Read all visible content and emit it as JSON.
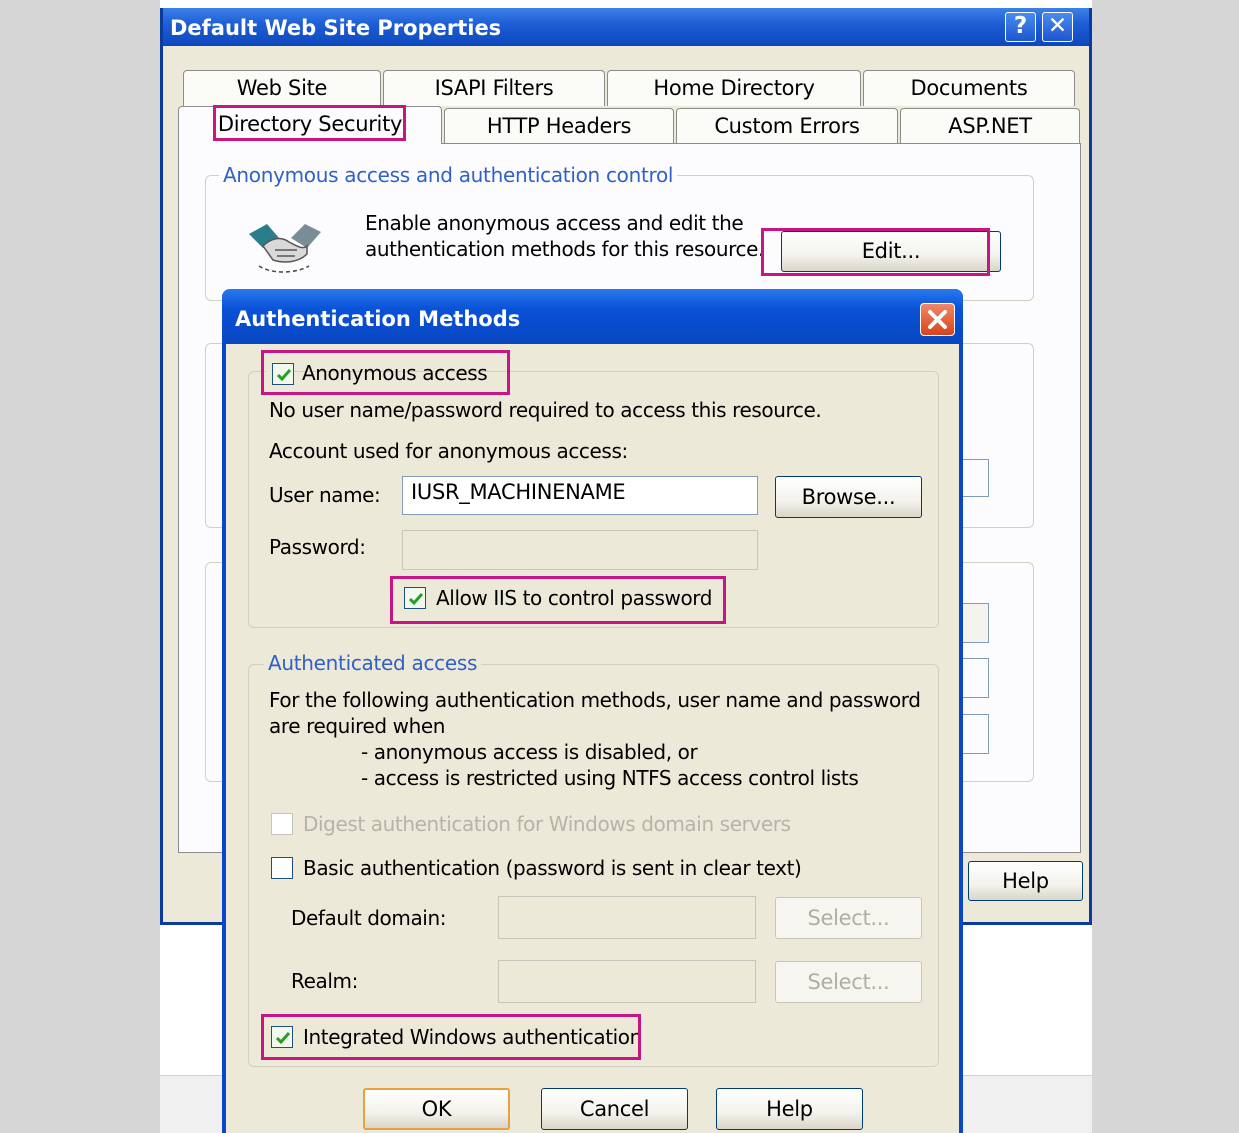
{
  "outer_dialog": {
    "title": "Default Web Site Properties",
    "help_glyph": "?",
    "close_glyph": "✕",
    "tabs_row1": [
      "Web Site",
      "ISAPI Filters",
      "Home Directory",
      "Documents"
    ],
    "tabs_row2": [
      "Directory Security",
      "HTTP Headers",
      "Custom Errors",
      "ASP.NET"
    ],
    "active_tab": "Directory Security",
    "anon_group": {
      "legend": "Anonymous access and authentication control",
      "description_line1": "Enable anonymous access and edit the",
      "description_line2": "authentication methods for this resource.",
      "edit_button": "Edit...",
      "icon": "handshake-icon"
    },
    "help_button": "Help"
  },
  "auth_dialog": {
    "title": "Authentication Methods",
    "close_icon": "close-icon",
    "anonymous": {
      "checkbox_label": "Anonymous access",
      "checked": true,
      "description": "No user name/password required to access this resource.",
      "account_caption": "Account used for anonymous access:",
      "username_label": "User name:",
      "username_value": "IUSR_MACHINENAME",
      "browse_button": "Browse...",
      "password_label": "Password:",
      "password_value": "",
      "allow_iis_label": "Allow IIS to control password",
      "allow_iis_checked": true
    },
    "authenticated": {
      "legend": "Authenticated access",
      "desc_line1": "For the following authentication methods, user name and password",
      "desc_line2": "are required when",
      "desc_line3": "- anonymous access is disabled, or",
      "desc_line4": "- access is restricted using NTFS access control lists",
      "digest_label": "Digest authentication for Windows domain servers",
      "digest_checked": false,
      "basic_label": "Basic authentication (password is sent in clear text)",
      "basic_checked": false,
      "default_domain_label": "Default domain:",
      "default_domain_value": "",
      "realm_label": "Realm:",
      "realm_value": "",
      "select_button": "Select...",
      "integrated_label": "Integrated Windows authentication",
      "integrated_checked": true
    },
    "ok_button": "OK",
    "cancel_button": "Cancel",
    "help_button": "Help"
  }
}
